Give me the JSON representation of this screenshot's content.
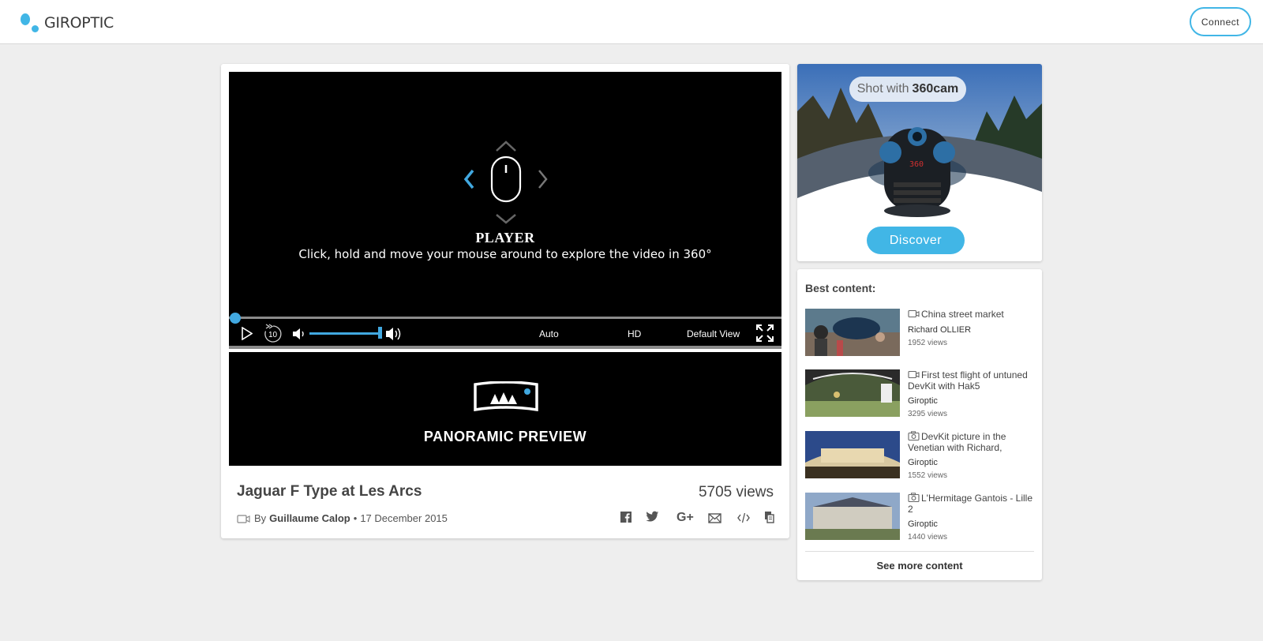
{
  "header": {
    "brand": "GIROPTIC",
    "connect_label": "Connect"
  },
  "player": {
    "hint_title": "PLAYER",
    "hint_text": "Click, hold and move your mouse around to explore the video in 360°",
    "progress_percent": 0,
    "volume_percent": 100,
    "rewind_label": "10",
    "quality_auto": "Auto",
    "quality_hd": "HD",
    "view_mode": "Default View"
  },
  "panoramic": {
    "label": "PANORAMIC PREVIEW"
  },
  "video": {
    "title": "Jaguar F Type at Les Arcs",
    "views": "5705 views",
    "by_prefix": "By",
    "author": "Guillaume Calop",
    "separator": "•",
    "date": "17 December 2015"
  },
  "ad": {
    "shot_with": "Shot with",
    "product": "360cam",
    "camera_label": "360",
    "discover_label": "Discover"
  },
  "best_content": {
    "title": "Best content:",
    "items": [
      {
        "type": "video-icon",
        "title": "China street market",
        "author": "Richard OLLIER",
        "views": "1952 views"
      },
      {
        "type": "video-icon",
        "title": "First test flight of untuned DevKit with Hak5",
        "author": "Giroptic",
        "views": "3295 views"
      },
      {
        "type": "photo-icon",
        "title": "DevKit picture in the Venetian with Richard,",
        "author": "Giroptic",
        "views": "1552 views"
      },
      {
        "type": "photo-icon",
        "title": "L'Hermitage Gantois - Lille 2",
        "author": "Giroptic",
        "views": "1440 views"
      }
    ],
    "see_more_label": "See more content"
  },
  "colors": {
    "accent": "#41b6e6",
    "player_bg": "#000000",
    "page_bg": "#eeeeee"
  }
}
